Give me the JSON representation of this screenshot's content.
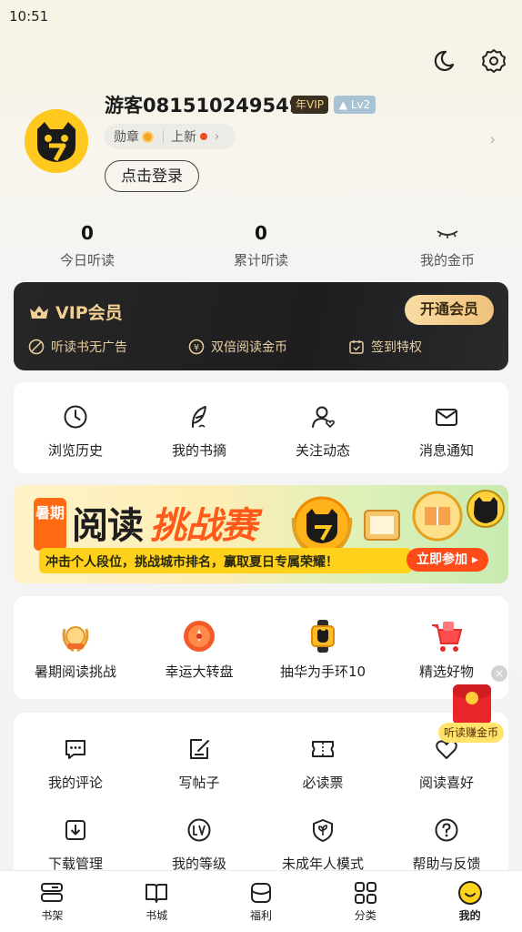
{
  "status_bar": {
    "time": "10:51"
  },
  "profile": {
    "username": "游客081510249549",
    "vip_badge": "年VIP",
    "level_badge": "Lv2",
    "medal_label": "勋章",
    "new_label": "上新",
    "login_button": "点击登录"
  },
  "stats": [
    {
      "value": "0",
      "label": "今日听读"
    },
    {
      "value": "0",
      "label": "累计听读"
    },
    {
      "value": "",
      "label": "我的金币"
    }
  ],
  "vip": {
    "title": "VIP会员",
    "button": "开通会员",
    "perks": [
      "听读书无广告",
      "双倍阅读金币",
      "签到特权"
    ],
    "accent": "#f1cf92"
  },
  "quick_links": [
    {
      "label": "浏览历史",
      "icon": "clock-icon"
    },
    {
      "label": "我的书摘",
      "icon": "feather-icon"
    },
    {
      "label": "关注动态",
      "icon": "user-heart-icon"
    },
    {
      "label": "消息通知",
      "icon": "envelope-icon"
    }
  ],
  "banner": {
    "tag": "暑期",
    "title_part1": "阅读",
    "title_part2": "挑战赛",
    "subtitle": "冲击个人段位，挑战城市排名，赢取夏日专属荣耀！",
    "cta": "立即参加"
  },
  "activities": [
    {
      "label": "暑期阅读挑战",
      "icon": "laurel-medal-icon"
    },
    {
      "label": "幸运大转盘",
      "icon": "lucky-wheel-icon"
    },
    {
      "label": "抽华为手环10",
      "icon": "smart-band-icon"
    },
    {
      "label": "精选好物",
      "icon": "shopping-cart-icon"
    }
  ],
  "services": [
    {
      "label": "我的评论",
      "icon": "comment-icon"
    },
    {
      "label": "写帖子",
      "icon": "edit-post-icon"
    },
    {
      "label": "必读票",
      "icon": "ticket-icon"
    },
    {
      "label": "阅读喜好",
      "icon": "heart-icon"
    },
    {
      "label": "下载管理",
      "icon": "download-icon"
    },
    {
      "label": "我的等级",
      "icon": "level-icon"
    },
    {
      "label": "未成年人模式",
      "icon": "leaf-shield-icon"
    },
    {
      "label": "帮助与反馈",
      "icon": "help-icon"
    }
  ],
  "floating": {
    "label": "听读赚金币",
    "close": "×"
  },
  "tabs": [
    {
      "label": "书架",
      "icon": "bookshelf-icon"
    },
    {
      "label": "书城",
      "icon": "book-icon"
    },
    {
      "label": "福利",
      "icon": "welfare-icon"
    },
    {
      "label": "分类",
      "icon": "category-icon"
    },
    {
      "label": "我的",
      "icon": "smile-face-icon",
      "active": true
    }
  ]
}
